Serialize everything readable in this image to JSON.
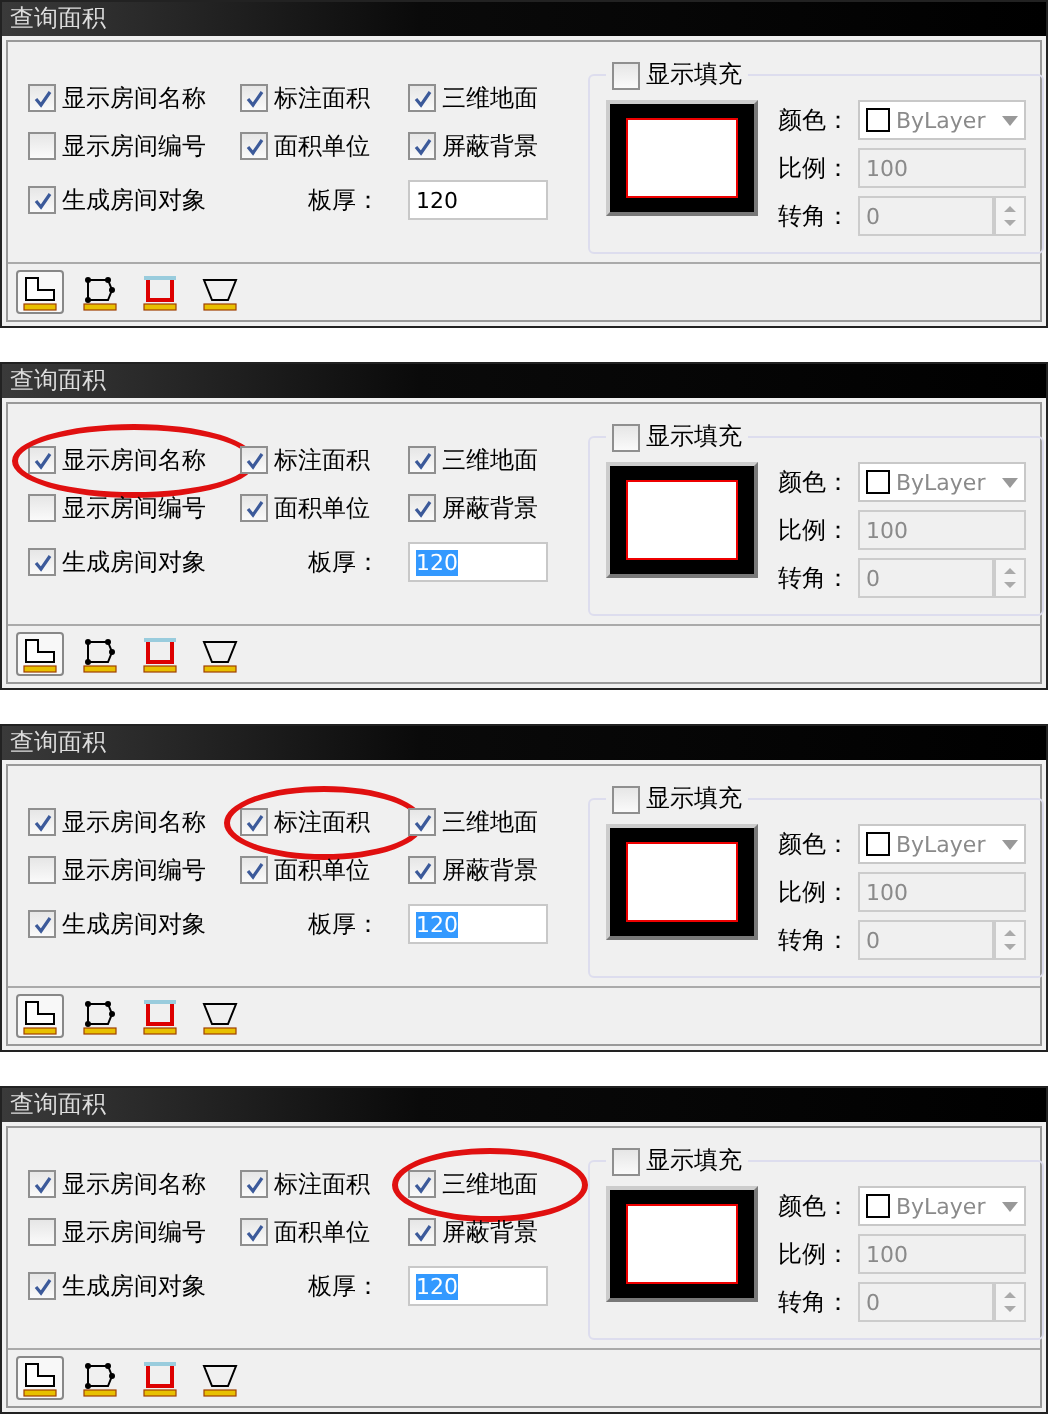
{
  "panels": [
    {
      "title": "查询面积",
      "checkboxes": [
        {
          "label": "显示房间名称",
          "checked": true,
          "circled": false
        },
        {
          "label": "标注面积",
          "checked": true,
          "circled": false
        },
        {
          "label": "三维地面",
          "checked": true,
          "circled": false
        },
        {
          "label": "显示房间编号",
          "checked": false,
          "circled": false
        },
        {
          "label": "面积单位",
          "checked": true,
          "circled": false
        },
        {
          "label": "屏蔽背景",
          "checked": true,
          "circled": false
        },
        {
          "label": "生成房间对象",
          "checked": true,
          "circled": false
        }
      ],
      "thickness": {
        "label": "板厚：",
        "value": "120",
        "selected": false
      },
      "fill": {
        "label": "显示填充",
        "checked": false,
        "color_label": "颜色：",
        "color_value": "ByLayer",
        "scale_label": "比例：",
        "scale_value": "100",
        "angle_label": "转角：",
        "angle_value": "0"
      },
      "tools": [
        {
          "selected": true
        },
        {
          "selected": false
        },
        {
          "selected": false
        },
        {
          "selected": false
        }
      ]
    },
    {
      "title": "查询面积",
      "checkboxes": [
        {
          "label": "显示房间名称",
          "checked": true,
          "circled": true
        },
        {
          "label": "标注面积",
          "checked": true,
          "circled": false
        },
        {
          "label": "三维地面",
          "checked": true,
          "circled": false
        },
        {
          "label": "显示房间编号",
          "checked": false,
          "circled": false
        },
        {
          "label": "面积单位",
          "checked": true,
          "circled": false
        },
        {
          "label": "屏蔽背景",
          "checked": true,
          "circled": false
        },
        {
          "label": "生成房间对象",
          "checked": true,
          "circled": false
        }
      ],
      "thickness": {
        "label": "板厚：",
        "value": "120",
        "selected": true
      },
      "fill": {
        "label": "显示填充",
        "checked": false,
        "color_label": "颜色：",
        "color_value": "ByLayer",
        "scale_label": "比例：",
        "scale_value": "100",
        "angle_label": "转角：",
        "angle_value": "0"
      },
      "tools": [
        {
          "selected": true
        },
        {
          "selected": false
        },
        {
          "selected": false
        },
        {
          "selected": false
        }
      ]
    },
    {
      "title": "查询面积",
      "checkboxes": [
        {
          "label": "显示房间名称",
          "checked": true,
          "circled": false
        },
        {
          "label": "标注面积",
          "checked": true,
          "circled": true
        },
        {
          "label": "三维地面",
          "checked": true,
          "circled": false
        },
        {
          "label": "显示房间编号",
          "checked": false,
          "circled": false
        },
        {
          "label": "面积单位",
          "checked": true,
          "circled": false
        },
        {
          "label": "屏蔽背景",
          "checked": true,
          "circled": false
        },
        {
          "label": "生成房间对象",
          "checked": true,
          "circled": false
        }
      ],
      "thickness": {
        "label": "板厚：",
        "value": "120",
        "selected": true
      },
      "fill": {
        "label": "显示填充",
        "checked": false,
        "color_label": "颜色：",
        "color_value": "ByLayer",
        "scale_label": "比例：",
        "scale_value": "100",
        "angle_label": "转角：",
        "angle_value": "0"
      },
      "tools": [
        {
          "selected": true
        },
        {
          "selected": false
        },
        {
          "selected": false
        },
        {
          "selected": false
        }
      ]
    },
    {
      "title": "查询面积",
      "checkboxes": [
        {
          "label": "显示房间名称",
          "checked": true,
          "circled": false
        },
        {
          "label": "标注面积",
          "checked": true,
          "circled": false
        },
        {
          "label": "三维地面",
          "checked": true,
          "circled": true
        },
        {
          "label": "显示房间编号",
          "checked": false,
          "circled": false
        },
        {
          "label": "面积单位",
          "checked": true,
          "circled": false
        },
        {
          "label": "屏蔽背景",
          "checked": true,
          "circled": false
        },
        {
          "label": "生成房间对象",
          "checked": true,
          "circled": false
        }
      ],
      "thickness": {
        "label": "板厚：",
        "value": "120",
        "selected": true
      },
      "fill": {
        "label": "显示填充",
        "checked": false,
        "color_label": "颜色：",
        "color_value": "ByLayer",
        "scale_label": "比例：",
        "scale_value": "100",
        "angle_label": "转角：",
        "angle_value": "0"
      },
      "tools": [
        {
          "selected": true
        },
        {
          "selected": false
        },
        {
          "selected": false
        },
        {
          "selected": false
        }
      ]
    }
  ]
}
